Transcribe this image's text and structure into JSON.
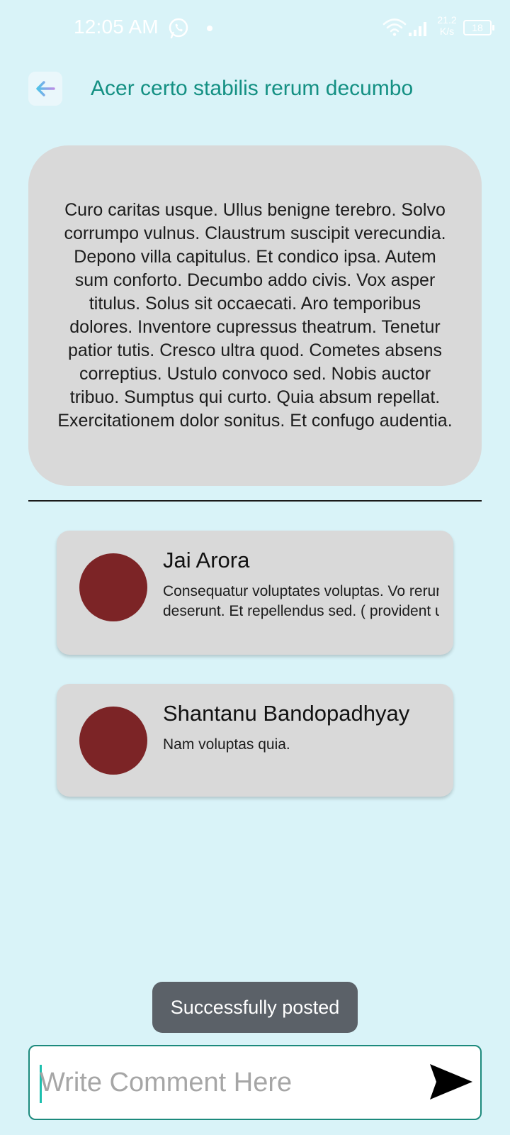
{
  "status_bar": {
    "time": "12:05 AM",
    "network_speed_value": "21.2",
    "network_speed_unit": "K/s",
    "battery": "18"
  },
  "header": {
    "back_icon": "arrow-left-icon",
    "title": "Acer certo stabilis rerum decumbo"
  },
  "post": {
    "body": "Curo caritas usque. Ullus benigne terebro. Solvo corrumpo vulnus. Claustrum suscipit verecundia. Depono villa capitulus. Et condico ipsa. Autem sum conforto. Decumbo addo civis. Vox asper titulus. Solus sit occaecati. Aro temporibus dolores. Inventore cupressus theatrum. Tenetur patior tutis. Cresco ultra quod. Cometes absens correptius. Ustulo convoco sed. Nobis auctor tribuo. Sumptus qui curto. Quia absum repellat. Exercitationem dolor sonitus. Et confugo audentia."
  },
  "comments": [
    {
      "author": "Jai Arora",
      "text": "Consequatur voluptates voluptas. Vo rerum deserunt. Et repellendus sed. ( provident ut."
    },
    {
      "author": "Shantanu Bandopadhyay",
      "text": "Nam voluptas quia."
    }
  ],
  "toast": {
    "message": "Successfully posted"
  },
  "comment_input": {
    "placeholder": "Write Comment Here",
    "value": "",
    "send_icon": "send-icon"
  },
  "colors": {
    "background": "#d9f3f8",
    "accent": "#149083",
    "card": "#d9d9d9",
    "avatar": "#7c2426",
    "toast": "#5b6168"
  }
}
